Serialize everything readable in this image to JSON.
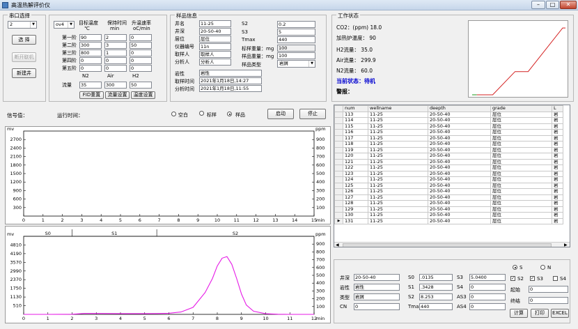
{
  "window": {
    "title": "高温热解评价仪",
    "minimize": "–",
    "maximize": "□",
    "close": "✕"
  },
  "port": {
    "legend": "串口选择",
    "port_value": "2",
    "select_btn": "选 择",
    "disconnect_btn": "断开联机",
    "new_well_btn": "新建井"
  },
  "oven": {
    "oven_value": "ov4",
    "col1": "目标温度",
    "col1_unit": "℃",
    "col2": "保持时间",
    "col2_unit": "min",
    "col3": "升温速率",
    "col3_unit": "oC/min",
    "stages": [
      {
        "label": "第一阶",
        "target": "90",
        "hold": "2",
        "rate": "0"
      },
      {
        "label": "第二阶",
        "target": "300",
        "hold": "3",
        "rate": "50"
      },
      {
        "label": "第三阶",
        "target": "800",
        "hold": "1",
        "rate": "0"
      },
      {
        "label": "第四阶",
        "target": "0",
        "hold": "0",
        "rate": "0"
      },
      {
        "label": "第五阶",
        "target": "0",
        "hold": "0",
        "rate": "0"
      }
    ],
    "gas_n2": "N2",
    "gas_air": "Air",
    "gas_h2": "H2",
    "flow_label": "流量",
    "flow_n2": "35",
    "flow_air": "300",
    "flow_h2": "50",
    "btn_fid": "FID重置",
    "btn_flow": "流量设置",
    "btn_temp": "温度设置"
  },
  "sample": {
    "legend": "样品信息",
    "well_name_label": "井名",
    "well_name": "11-25",
    "depth_label": "井深",
    "depth": "20-50-40",
    "layer_label": "层位",
    "layer": "层位",
    "instrument_label": "仪器编号",
    "instrument": "11n",
    "sampler_label": "取样人",
    "sampler": "取样人",
    "analyst_label": "分析人",
    "analyst": "分析人",
    "s2_label": "S2",
    "s2": "0.2",
    "s3_label": "S3",
    "s3": "5",
    "tmax_label": "Tmax",
    "tmax": "440",
    "std_weight_label": "标样重量：mg",
    "std_weight": "100",
    "sample_weight_label": "样品重量：mg",
    "sample_weight": "100",
    "sample_type_label": "样品类型",
    "sample_type": "岩屑",
    "lithology_label": "岩性",
    "lithology": "岩性",
    "sample_time_label": "取样时间",
    "sample_time": "2021年1月18日,14:27",
    "analysis_time_label": "分析时间",
    "analysis_time": "2021年1月18日,11:55"
  },
  "status": {
    "legend": "工作状态",
    "co2": "CO2：(ppm) 18.0",
    "furnace_temp": "加热炉温度：    90",
    "h2_flow": "H2流量：  35.0",
    "air_flow": "Air流量：  299.9",
    "n2_flow": "N2流量：  60.0",
    "current_state": "当前状态：待机",
    "alarm": "警报："
  },
  "control": {
    "signal_label": "信号值：",
    "run_time_label": "运行时间：",
    "radio_blank": "空白",
    "radio_std": "标样",
    "radio_sample": "样品",
    "start_btn": "启动",
    "stop_btn": "停止"
  },
  "table": {
    "columns": [
      "num",
      "wellname",
      "deepth",
      "grade",
      "L"
    ],
    "rows": [
      [
        "113",
        "11-25",
        "20-50-40",
        "层位",
        "岩"
      ],
      [
        "114",
        "11-25",
        "20-50-40",
        "层位",
        "岩"
      ],
      [
        "115",
        "11-25",
        "20-50-40",
        "层位",
        "岩"
      ],
      [
        "116",
        "11-25",
        "20-50-40",
        "层位",
        "岩"
      ],
      [
        "117",
        "11-25",
        "20-50-40",
        "层位",
        "岩"
      ],
      [
        "118",
        "11-25",
        "20-50-40",
        "层位",
        "岩"
      ],
      [
        "119",
        "11-25",
        "20-50-40",
        "层位",
        "岩"
      ],
      [
        "120",
        "11-25",
        "20-50-40",
        "层位",
        "岩"
      ],
      [
        "121",
        "11-25",
        "20-50-40",
        "层位",
        "岩"
      ],
      [
        "122",
        "11-25",
        "20-50-40",
        "层位",
        "岩"
      ],
      [
        "123",
        "11-25",
        "20-50-40",
        "层位",
        "岩"
      ],
      [
        "124",
        "11-25",
        "20-50-40",
        "层位",
        "岩"
      ],
      [
        "125",
        "11-25",
        "20-50-40",
        "层位",
        "岩"
      ],
      [
        "126",
        "11-25",
        "20-50-40",
        "层位",
        "岩"
      ],
      [
        "127",
        "11-25",
        "20-50-40",
        "层位",
        "岩"
      ],
      [
        "128",
        "11-25",
        "20-50-40",
        "层位",
        "岩"
      ],
      [
        "129",
        "11-25",
        "20-50-40",
        "层位",
        "岩"
      ],
      [
        "130",
        "11-25",
        "20-50-40",
        "层位",
        "岩"
      ],
      [
        "131",
        "11-25",
        "20-50-40",
        "层位",
        "岩"
      ]
    ]
  },
  "result": {
    "radio_s": "S",
    "radio_n": "N",
    "depth_label": "井深",
    "depth": "20-50-40",
    "lithology_label": "岩性",
    "lithology": "岩性",
    "type_label": "类型",
    "type": "岩屑",
    "cn_label": "CN",
    "cn": "0",
    "s0_label": "S0",
    "s0": ".0135",
    "s1_label": "S1",
    "s1": ".3428",
    "s2_label": "S2",
    "s2": "8.253",
    "tmax_label": "Tmax",
    "tmax": "440",
    "s3_label": "S3",
    "s3": "5.0400",
    "s4_label": "S4",
    "s4": "0",
    "as3_label": "AS3",
    "as3": "0",
    "as4_label": "AS4",
    "as4": "0",
    "chk_s2": "S2",
    "chk_s3": "S3",
    "chk_s4": "S4",
    "start_label": "起始",
    "start": "0",
    "end_label": "终结",
    "end": "0",
    "calc_btn": "计算",
    "print_btn": "打印",
    "excel_btn": "EXCEL"
  },
  "colors": {
    "fid_curve": "#e619e6",
    "temp_curve": "#d42020",
    "status_blue": "#0000d0"
  },
  "chart_data": [
    {
      "type": "line",
      "name": "upper",
      "ylabel_left": "mv",
      "ylabel_right": "ppm",
      "y_left_ticks": [
        "300",
        "600",
        "900",
        "1200",
        "1500",
        "1800",
        "2100",
        "2400",
        "2700"
      ],
      "y_right_ticks": [
        "100",
        "200",
        "300",
        "400",
        "500",
        "600",
        "700",
        "800",
        "900"
      ],
      "x_ticks": [
        "0",
        "1",
        "2",
        "3",
        "4",
        "5",
        "6",
        "7",
        "8",
        "9",
        "10",
        "11",
        "12",
        "13",
        "14",
        "15"
      ],
      "xunit": "min",
      "xlim": [
        0,
        15
      ],
      "ylim": [
        0,
        3000
      ],
      "series": []
    },
    {
      "type": "line",
      "name": "lower",
      "ylabel_left": "mv",
      "ylabel_right": "ppm",
      "y_left_ticks": [
        "510",
        "1130",
        "1750",
        "2370",
        "2990",
        "3570",
        "4190",
        "4810"
      ],
      "y_right_ticks": [
        "100",
        "200",
        "300",
        "400",
        "500",
        "600",
        "700",
        "800",
        "900"
      ],
      "x_ticks": [
        "0",
        "1",
        "2",
        "3",
        "4",
        "5",
        "6",
        "7",
        "8",
        "9",
        "10",
        "11",
        "12"
      ],
      "xunit": "min",
      "xlim": [
        0,
        12
      ],
      "ylim": [
        0,
        5000
      ],
      "regions": [
        "S0",
        "S1",
        "S2"
      ],
      "region_bounds": [
        0,
        2,
        5.5,
        12
      ],
      "series": [
        {
          "x": [
            0,
            0.5,
            1,
            1.5,
            2,
            2.5,
            3,
            3.5,
            4,
            4.5,
            5,
            5.5,
            6,
            6.5,
            7,
            7.5,
            7.8,
            8,
            8.2,
            8.4,
            8.6,
            8.8,
            9,
            9.2,
            9.5,
            10,
            10.5,
            11,
            12
          ],
          "y": [
            0,
            0,
            0,
            5,
            10,
            60,
            60,
            55,
            50,
            50,
            50,
            55,
            70,
            150,
            450,
            1400,
            2300,
            3100,
            3600,
            3700,
            3200,
            2300,
            1300,
            600,
            200,
            40,
            10,
            0,
            0
          ]
        }
      ]
    },
    {
      "type": "line",
      "name": "temperature-program",
      "x": [
        0,
        0.05,
        0.22,
        0.46,
        0.6,
        0.97,
        1
      ],
      "y": [
        0,
        0,
        0,
        0.33,
        0.33,
        0.95,
        0.95
      ]
    }
  ]
}
